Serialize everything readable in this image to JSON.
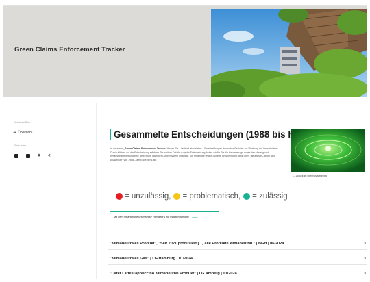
{
  "hero": {
    "title": "Green Claims Enforcement Tracker"
  },
  "sidebar": {
    "label_top": "Auf einen Blick",
    "back_label": "Übersicht",
    "share_label": "Seite teilen",
    "share_icons": [
      "linkedin-icon",
      "facebook-icon",
      "x-icon",
      "share-icon"
    ]
  },
  "main": {
    "title": "Gesammelte Entscheidungen (1988 bis heute)",
    "intro_lead": "In unserem ",
    "intro_bold": "„Green Claims Enforcement Tracker\"",
    "intro_rest": " finden Sie – laufend aktualisiert – Entscheidungen deutscher Gerichte zur Werbung mit Umweltclaims. Durch Klicken auf die Entscheidung erfahren Sie weitere Details zu jeder Entscheidung finden wir für Sie die Kernaussage sowie den Hintergrund herausgearbeitet und eine Bewertung nach dem Ampelsystem angelegt. Sie finden die jeweils jüngste Entscheidung ganz oben, die älteste – BGH „Bio-Allzwecker\" von 1988 – am Ende der Liste.",
    "thumb_caption": "Zurück zu Green Advertising",
    "legend": [
      {
        "color": "#e31e24",
        "label": "= unzulässig,"
      },
      {
        "color": "#f5c518",
        "label": "= problematisch,"
      },
      {
        "color": "#19b394",
        "label": "= zulässig"
      }
    ],
    "mobile_button": "Mit dem Smartphone unterwegs? Hier geht's zur mobilen Ansicht!",
    "accordion": [
      "\"Klimaneutrales Produkt\", \"Seit 2021 produziert [...] alle Produkte klimaneutral.\" | BGH | 06/2024",
      "\"Klimaneutrales Gas\" | LG Hamburg | 01/2024",
      "\"Cafet Latte Cappuccino Klimaneutral Produkt\" | LG Amberg | 01/2024"
    ]
  },
  "colors": {
    "accent": "#19b394",
    "hero_bg": "#dcdbd8"
  }
}
